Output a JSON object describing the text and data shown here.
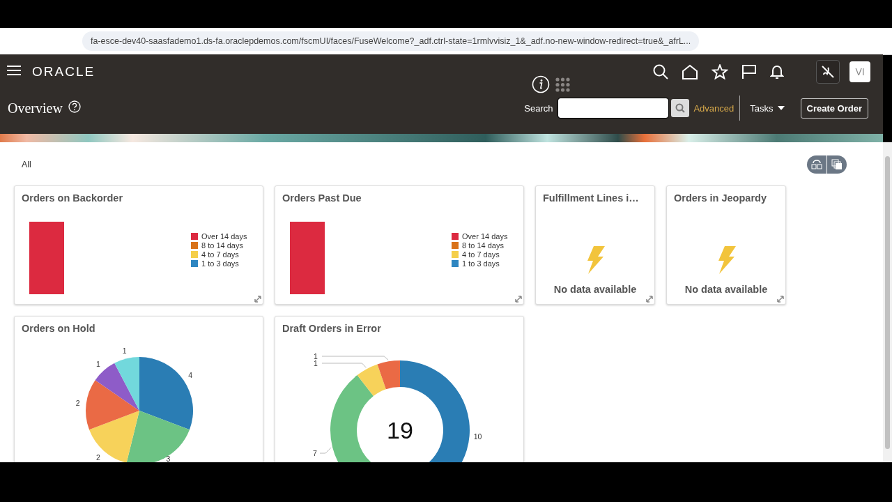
{
  "browser": {
    "url": "fa-esce-dev40-saasfademo1.ds-fa.oraclepdemos.com/fscmUI/faces/FuseWelcome?_adf.ctrl-state=1rmlvvisiz_1&_adf.no-new-window-redirect=true&_afrL..."
  },
  "header": {
    "logo": "ORACLE",
    "avatar": "VI"
  },
  "page": {
    "title": "Overview"
  },
  "search": {
    "label": "Search",
    "advanced": "Advanced"
  },
  "actions": {
    "tasks": "Tasks",
    "create": "Create Order"
  },
  "filter": "All",
  "cards": [
    {
      "kind": "bar",
      "title": "Orders on Backorder",
      "legend": [
        {
          "label": "Over 14 days",
          "color": "#dc2a40"
        },
        {
          "label": "8 to 14 days",
          "color": "#d9731a"
        },
        {
          "label": "4 to 7 days",
          "color": "#f5cf4a"
        },
        {
          "label": "1 to 3 days",
          "color": "#2e86c1"
        }
      ]
    },
    {
      "kind": "bar",
      "title": "Orders Past Due",
      "legend": [
        {
          "label": "Over 14 days",
          "color": "#dc2a40"
        },
        {
          "label": "8 to 14 days",
          "color": "#d9731a"
        },
        {
          "label": "4 to 7 days",
          "color": "#f5cf4a"
        },
        {
          "label": "1 to 3 days",
          "color": "#2e86c1"
        }
      ]
    },
    {
      "kind": "empty",
      "title": "Fulfillment Lines i…",
      "message": "No data available"
    },
    {
      "kind": "empty",
      "title": "Orders in Jeopardy",
      "message": "No data available"
    },
    {
      "kind": "pie",
      "title": "Orders on Hold",
      "chart_data": {
        "type": "pie",
        "values": [
          4,
          3,
          2,
          2,
          1,
          1
        ],
        "data_labels": true
      }
    },
    {
      "kind": "donut",
      "title": "Draft Orders in Error",
      "center_label": "19",
      "chart_data": {
        "type": "donut",
        "values": [
          10,
          7,
          1,
          1
        ],
        "data_labels": true
      }
    }
  ]
}
